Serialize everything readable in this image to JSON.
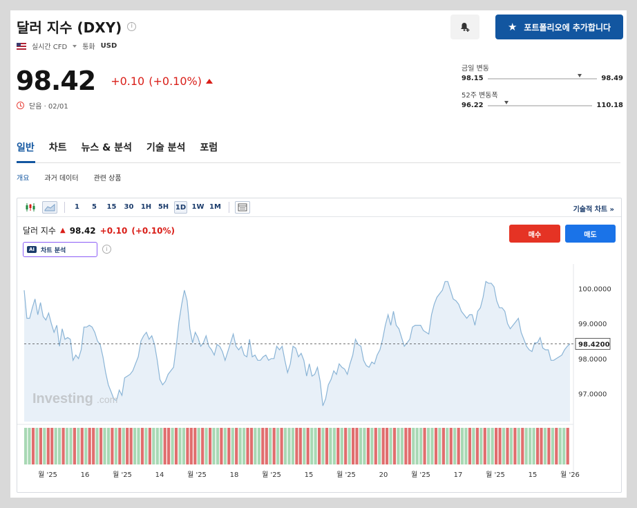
{
  "header": {
    "title": "달러 지수 (DXY)",
    "info_icon": "info-icon",
    "realtime_label": "실시간 CFD",
    "currency_label": "통화",
    "currency": "USD",
    "price": "98.42",
    "change": "+0.10",
    "change_pct": "(+0.10%)",
    "closed_label": "닫음 · 02/01",
    "portfolio_button": "포트폴리오에 추가합니다"
  },
  "ranges": {
    "day_label": "금일 변동",
    "day_low": "98.15",
    "day_high": "98.49",
    "day_position": 0.82,
    "week52_label": "52주 변동폭",
    "week52_low": "96.22",
    "week52_high": "110.18",
    "week52_position": 0.16
  },
  "tabs": [
    "일반",
    "차트",
    "뉴스 & 분석",
    "기술 분석",
    "포럼"
  ],
  "subtabs": [
    "개요",
    "과거 데이터",
    "관련 상품"
  ],
  "toolbar": {
    "timeframes": [
      "1",
      "5",
      "15",
      "30",
      "1H",
      "5H",
      "1D",
      "1W",
      "1M"
    ],
    "active_timeframe": "1D",
    "tech_chart_link": "기술적 차트 »"
  },
  "chart_header": {
    "name": "달러 지수",
    "value": "98.42",
    "change": "+0.10",
    "change_pct": "(+0.10%)",
    "ai_badge": "AI",
    "ai_label": "차트 분석",
    "buy": "매수",
    "sell": "매도",
    "watermark": "Investing",
    "watermark_suffix": ".com"
  },
  "colors": {
    "accent": "#1256a0",
    "down": "#d91e18",
    "buy": "#e53324",
    "sell": "#1a73e8",
    "line": "#8ab4d6",
    "area": "#e8f0f8",
    "vol_up": "#a8d8b4",
    "vol_down": "#e06e6e"
  },
  "chart_data": {
    "type": "area",
    "ylim": [
      96.2,
      100.6
    ],
    "y_ticks": [
      "100.0000",
      "99.0000",
      "98.0000",
      "97.0000"
    ],
    "y_tick_values": [
      100,
      99,
      98,
      97
    ],
    "last_value": 98.42,
    "last_label": "98.4200",
    "x_tick_labels": [
      "월 '25",
      "16",
      "월 '25",
      "14",
      "월 '25",
      "18",
      "월 '25",
      "15",
      "월 '25",
      "20",
      "월 '25",
      "17",
      "월 '25",
      "15",
      "월 '26"
    ],
    "values": [
      99.95,
      99.15,
      99.15,
      99.45,
      99.7,
      99.25,
      99.6,
      99.2,
      99.1,
      99.3,
      99.0,
      98.75,
      98.95,
      98.35,
      98.85,
      98.55,
      98.6,
      98.55,
      97.95,
      98.1,
      98.0,
      98.25,
      98.9,
      98.9,
      98.95,
      98.9,
      98.75,
      98.5,
      98.4,
      98.05,
      97.6,
      97.25,
      97.05,
      96.85,
      96.8,
      97.1,
      96.95,
      97.45,
      97.5,
      97.55,
      97.65,
      97.85,
      98.05,
      98.5,
      98.65,
      98.75,
      98.55,
      98.65,
      98.4,
      97.95,
      97.4,
      97.25,
      97.35,
      97.55,
      97.65,
      97.75,
      98.35,
      99.05,
      99.55,
      99.95,
      99.65,
      98.85,
      98.45,
      98.75,
      98.6,
      98.35,
      98.45,
      98.65,
      98.35,
      98.25,
      98.1,
      98.4,
      98.35,
      98.2,
      97.95,
      98.2,
      98.45,
      98.7,
      98.35,
      98.25,
      98.35,
      98.1,
      98.05,
      98.55,
      98.05,
      98.1,
      97.95,
      97.95,
      98.05,
      98.1,
      97.95,
      98.0,
      98.0,
      98.35,
      98.25,
      98.35,
      97.95,
      97.6,
      97.85,
      98.35,
      98.3,
      98.05,
      98.15,
      97.95,
      97.5,
      97.85,
      97.5,
      97.55,
      97.75,
      97.35,
      96.65,
      96.85,
      97.25,
      97.4,
      97.65,
      97.55,
      97.85,
      97.75,
      97.7,
      97.55,
      97.85,
      98.1,
      98.55,
      98.4,
      98.35,
      97.95,
      97.8,
      97.75,
      97.9,
      97.85,
      98.1,
      98.25,
      98.55,
      98.95,
      99.25,
      98.95,
      99.35,
      98.95,
      98.85,
      98.6,
      98.35,
      98.45,
      98.55,
      98.9,
      98.95,
      98.95,
      98.95,
      98.8,
      98.75,
      98.7,
      99.25,
      99.55,
      99.75,
      99.85,
      99.95,
      100.2,
      100.2,
      99.95,
      99.7,
      99.65,
      99.55,
      99.35,
      99.25,
      99.15,
      99.25,
      99.25,
      98.95,
      99.35,
      99.45,
      99.75,
      100.2,
      100.15,
      100.15,
      100.05,
      99.65,
      99.45,
      99.45,
      99.35,
      99.0,
      98.85,
      98.95,
      99.05,
      99.15,
      98.75,
      98.55,
      98.35,
      98.25,
      98.2,
      98.45,
      98.45,
      98.6,
      98.3,
      98.25,
      98.25,
      97.95,
      97.95,
      98.0,
      98.05,
      98.1,
      98.25,
      98.35,
      98.42
    ],
    "volume_bars": "1101010011011010100101101010011010111001011000101011010101100110010101110010110101101010011010100101100111011010101011010101100101010111001010110"
  }
}
